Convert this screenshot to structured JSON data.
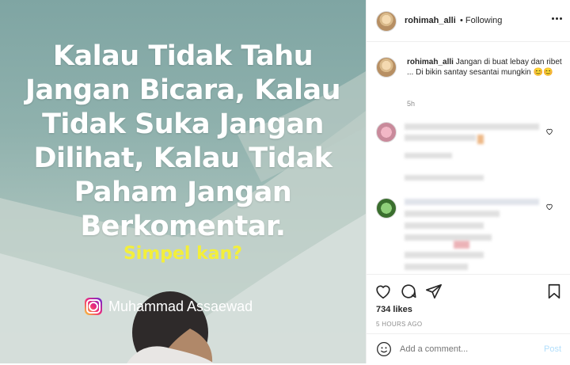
{
  "image": {
    "quote_lines": [
      "Kalau Tidak Tahu",
      "Jangan Bicara, Kalau",
      "Tidak Suka Jangan",
      "Dilihat, Kalau Tidak",
      "Paham Jangan",
      "Berkomentar."
    ],
    "tagline": "Simpel kan?",
    "credit": "Muhammad Assaewad"
  },
  "header": {
    "username": "rohimah_alli",
    "following": "• Following"
  },
  "caption": {
    "username": "rohimah_alli",
    "text": "Jangan di buat lebay dan ribet ... Di bikin santay sesantai mungkin 😊😊",
    "time": "5h"
  },
  "stats": {
    "likes": "734 likes",
    "posted_ago": "5 HOURS AGO"
  },
  "comment_box": {
    "placeholder": "Add a comment...",
    "post_label": "Post"
  },
  "icons": [
    "more-icon",
    "heart-icon",
    "comment-icon",
    "share-icon",
    "bookmark-icon",
    "emoji-icon",
    "instagram-icon"
  ],
  "colors": {
    "tagline": "#f3ef3b",
    "post_disabled": "#b2dffc",
    "text": "#262626",
    "muted": "#8e8e8e"
  }
}
